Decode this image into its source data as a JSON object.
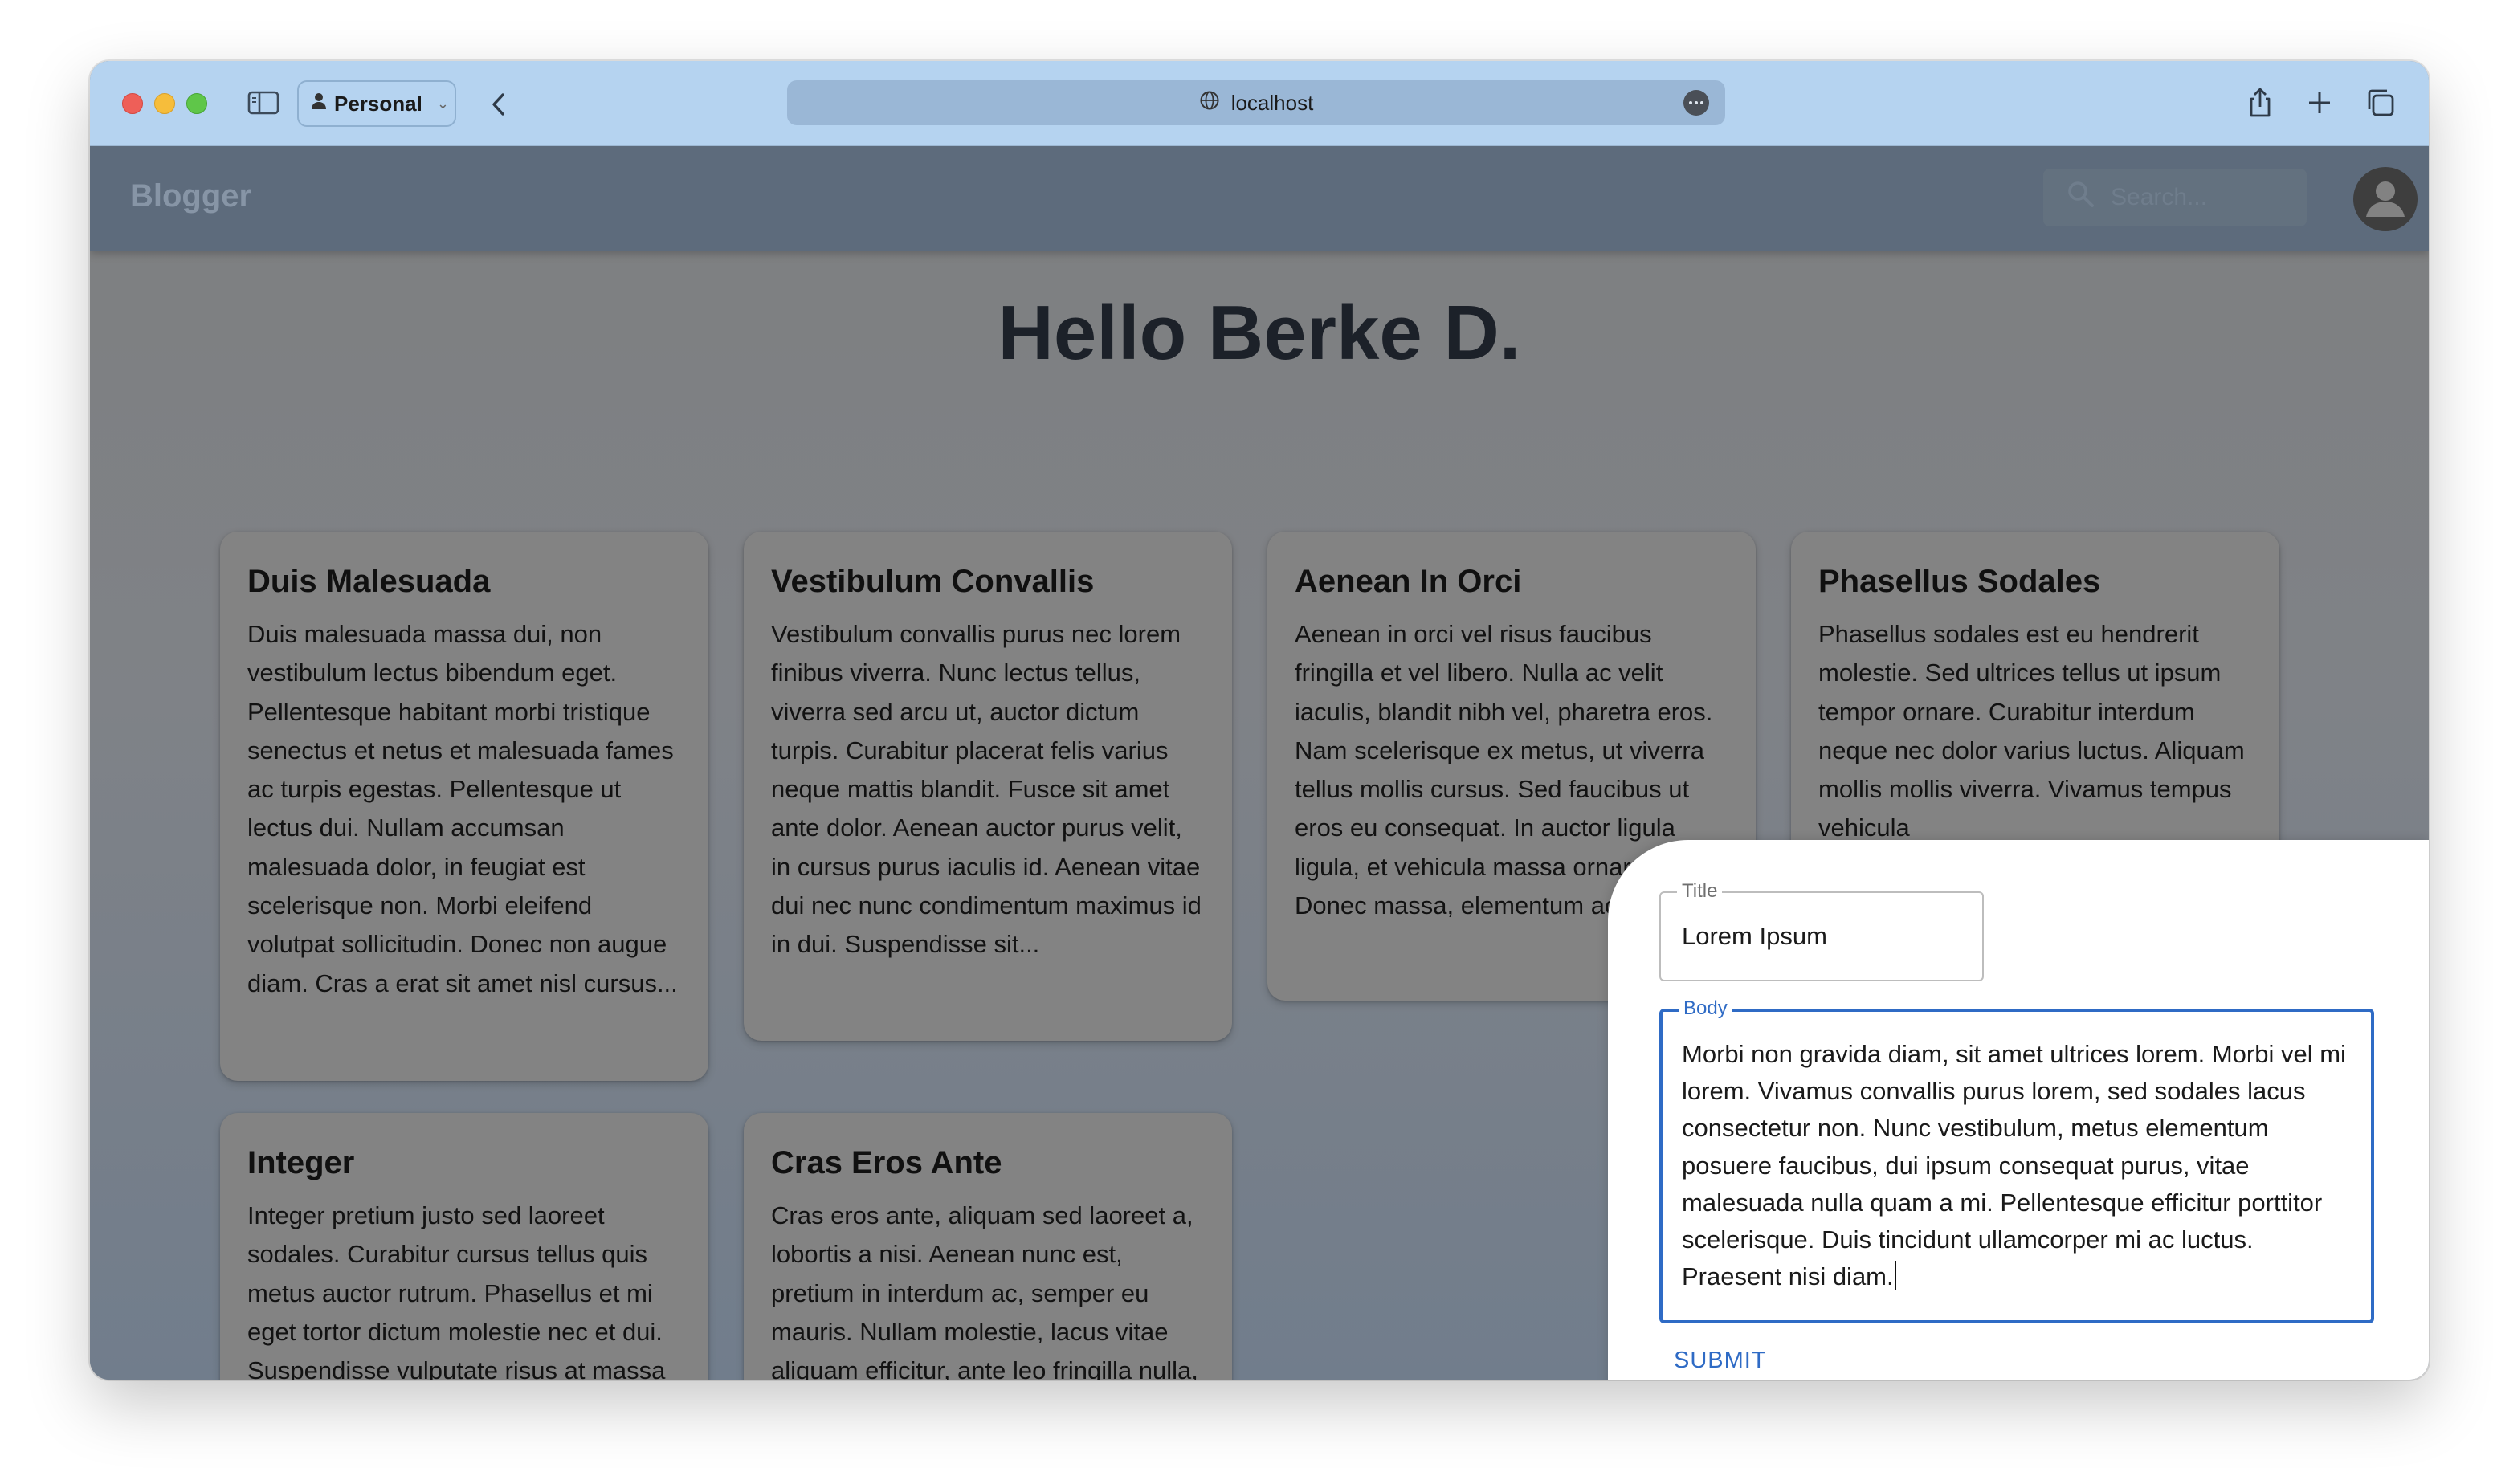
{
  "browser": {
    "profile_label": "Personal",
    "url": "localhost"
  },
  "app": {
    "brand": "Blogger",
    "search_placeholder": "Search..."
  },
  "greeting": "Hello Berke D.",
  "posts": [
    {
      "title": "Duis Malesuada",
      "body": "Duis malesuada massa dui, non vestibulum lectus bibendum eget. Pellentesque habitant morbi tristique senectus et netus et malesuada fames ac turpis egestas. Pellentesque ut lectus dui. Nullam accumsan malesuada dolor, in feugiat est scelerisque non. Morbi eleifend volutpat sollicitudin. Donec non augue diam. Cras a erat sit amet nisl cursus..."
    },
    {
      "title": "Vestibulum Convallis",
      "body": "Vestibulum convallis purus nec lorem finibus viverra. Nunc lectus tellus, viverra sed arcu ut, auctor dictum turpis. Curabitur placerat felis varius neque mattis blandit. Fusce sit amet ante dolor. Aenean auctor purus velit, in cursus purus iaculis id. Aenean vitae dui nec nunc condimentum maximus id in dui. Suspendisse sit..."
    },
    {
      "title": "Aenean In Orci",
      "body": "Aenean in orci vel risus faucibus fringilla et vel libero. Nulla ac velit iaculis, blandit nibh vel, pharetra eros. Nam scelerisque ex metus, ut viverra tellus mollis cursus. Sed faucibus ut eros eu consequat. In auctor ligula ligula, et vehicula massa ornare eget. Donec massa, elementum ac arcu..."
    },
    {
      "title": "Phasellus Sodales",
      "body": "Phasellus sodales est eu hendrerit molestie. Sed ultrices tellus ut ipsum tempor ornare. Curabitur interdum neque nec dolor varius luctus. Aliquam mollis mollis viverra. Vivamus tempus vehicula"
    },
    {
      "title": "Integer",
      "body": "Integer pretium justo sed laoreet sodales. Curabitur cursus tellus quis metus auctor rutrum. Phasellus et mi eget tortor dictum molestie nec et dui. Suspendisse vulputate risus at massa venenatis, eget aliquam"
    },
    {
      "title": "Cras Eros Ante",
      "body": "Cras eros ante, aliquam sed laoreet a, lobortis a nisi. Aenean nunc est, pretium in interdum ac, semper eu mauris. Nullam molestie, lacus vitae aliquam efficitur, ante leo fringilla nulla, a efficitur nulla leo et mauris."
    }
  ],
  "form": {
    "title_label": "Title",
    "title_value": "Lorem Ipsum",
    "body_label": "Body",
    "body_value": "Morbi non gravida diam, sit amet ultrices lorem. Morbi vel mi lorem. Vivamus convallis purus lorem, sed sodales lacus consectetur non. Nunc vestibulum, metus elementum posuere faucibus, dui ipsum consequat purus, vitae malesuada nulla quam a mi. Pellentesque efficitur porttitor scelerisque. Duis tincidunt ullamcorper mi ac luctus. Praesent nisi diam.",
    "submit_label": "SUBMIT"
  },
  "colors": {
    "accent": "#2f6bc5",
    "appbar": "#5d6b7c",
    "card": "#838383",
    "browser_chrome": "#b5d3f0"
  }
}
